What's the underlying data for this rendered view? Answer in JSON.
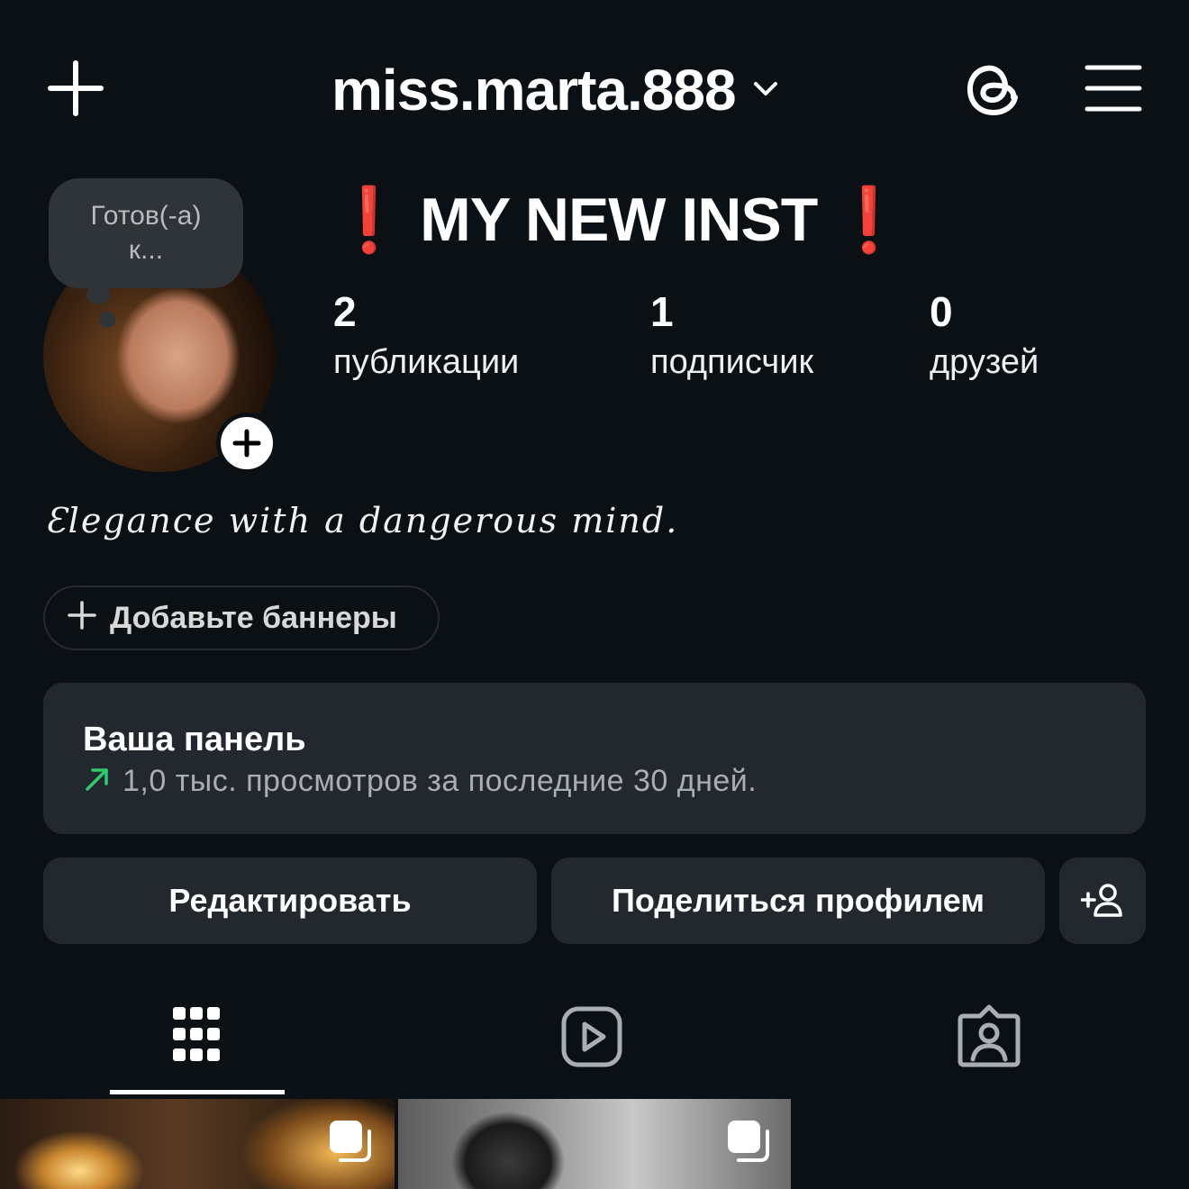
{
  "header": {
    "username": "miss.marta.888",
    "icons": [
      "plus-icon",
      "chevron-down-icon",
      "threads-icon",
      "hamburger-menu-icon"
    ]
  },
  "note": {
    "line1": "Готов(-а)",
    "line2": "к..."
  },
  "profile": {
    "display_name_prefix": "❗",
    "display_name": "MY NEW INST",
    "display_name_suffix": "❗",
    "bio": "Ɛlegance with a dangerous mind.",
    "stats": [
      {
        "value": "2",
        "label": "публикации"
      },
      {
        "value": "1",
        "label": "подписчик"
      },
      {
        "value": "0",
        "label": "друзей"
      }
    ]
  },
  "banner_chip": {
    "label": "Добавьте баннеры"
  },
  "dashboard": {
    "title": "Ваша панель",
    "subtitle": "1,0 тыс. просмотров за последние 30 дней.",
    "trend_color": "#2ecc71"
  },
  "buttons": {
    "edit": "Редактировать",
    "share": "Поделиться профилем"
  },
  "tabs": [
    "grid-icon",
    "reels-icon",
    "tagged-icon"
  ],
  "colors": {
    "background": "#0b1014",
    "surface": "#23282e",
    "accent_red": "#e0131c"
  }
}
